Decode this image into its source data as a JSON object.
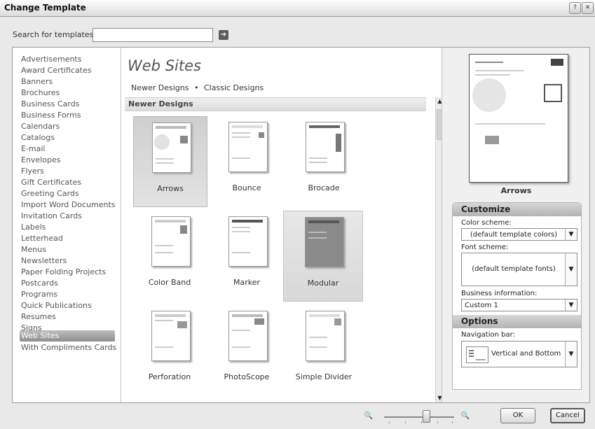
{
  "window": {
    "title": "Change Template",
    "help_glyph": "?",
    "close_glyph": "✕"
  },
  "search": {
    "label": "Search for templates:",
    "value": "",
    "placeholder": "",
    "go_glyph": "➔"
  },
  "categories": {
    "items": [
      "Advertisements",
      "Award Certificates",
      "Banners",
      "Brochures",
      "Business Cards",
      "Business Forms",
      "Calendars",
      "Catalogs",
      "E-mail",
      "Envelopes",
      "Flyers",
      "Gift Certificates",
      "Greeting Cards",
      "Import Word Documents",
      "Invitation Cards",
      "Labels",
      "Letterhead",
      "Menus",
      "Newsletters",
      "Paper Folding Projects",
      "Postcards",
      "Programs",
      "Quick Publications",
      "Resumes",
      "Signs",
      "Web Sites",
      "With Compliments Cards"
    ],
    "selected": "Web Sites"
  },
  "main": {
    "title": "Web Sites",
    "links": {
      "newer": "Newer Designs",
      "separator": "•",
      "classic": "Classic Designs"
    },
    "section_header": "Newer Designs",
    "templates": [
      {
        "name": "Arrows",
        "state": "selected"
      },
      {
        "name": "Bounce",
        "state": "normal"
      },
      {
        "name": "Brocade",
        "state": "normal"
      },
      {
        "name": "Color Band",
        "state": "normal"
      },
      {
        "name": "Marker",
        "state": "normal"
      },
      {
        "name": "Modular",
        "state": "hover"
      },
      {
        "name": "Perforation",
        "state": "normal"
      },
      {
        "name": "PhotoScope",
        "state": "normal"
      },
      {
        "name": "Simple Divider",
        "state": "normal"
      }
    ],
    "scroll_up_glyph": "▲",
    "scroll_down_glyph": "▼"
  },
  "preview": {
    "name": "Arrows"
  },
  "customize": {
    "header": "Customize",
    "color_scheme_label": "Color scheme:",
    "color_scheme_value": "(default template colors)",
    "font_scheme_label": "Font scheme:",
    "font_scheme_value": "(default template fonts)",
    "business_info_label": "Business information:",
    "business_info_value": "Custom 1"
  },
  "options": {
    "header": "Options",
    "nav_bar_label": "Navigation bar:",
    "nav_bar_value": "Vertical and Bottom"
  },
  "dropdown_glyph": "▼",
  "footer": {
    "zoom_out_glyph": "🔍",
    "zoom_in_glyph": "🔍",
    "zoom_level": 0.6,
    "ok_label": "OK",
    "cancel_label": "Cancel"
  }
}
